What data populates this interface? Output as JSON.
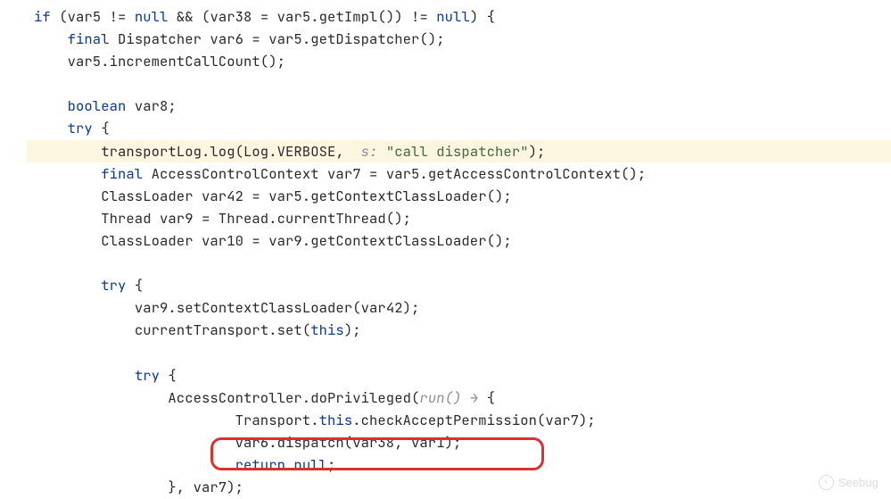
{
  "colors": {
    "keyword": "#0d3b8f",
    "string": "#446b3a",
    "inlay": "#8a8f97",
    "text": "#2b2b2b",
    "highlight_bg": "#fcf6e1",
    "redbox": "#d7322c"
  },
  "watermark": {
    "icon_label": "i",
    "text": "Seebug"
  },
  "lines": [
    {
      "indent": 0,
      "hl": false,
      "tokens": [
        {
          "t": "kw",
          "v": "if"
        },
        {
          "t": "plain",
          "v": " (var5 != "
        },
        {
          "t": "kw",
          "v": "null"
        },
        {
          "t": "plain",
          "v": " && (var38 = var5.getImpl()) != "
        },
        {
          "t": "kw",
          "v": "null"
        },
        {
          "t": "plain",
          "v": ") {"
        }
      ]
    },
    {
      "indent": 1,
      "hl": false,
      "tokens": [
        {
          "t": "kw",
          "v": "final"
        },
        {
          "t": "plain",
          "v": " Dispatcher var6 = var5.getDispatcher();"
        }
      ]
    },
    {
      "indent": 1,
      "hl": false,
      "tokens": [
        {
          "t": "plain",
          "v": "var5.incrementCallCount();"
        }
      ]
    },
    {
      "indent": 0,
      "hl": false,
      "tokens": []
    },
    {
      "indent": 1,
      "hl": false,
      "tokens": [
        {
          "t": "kw",
          "v": "boolean"
        },
        {
          "t": "plain",
          "v": " var8;"
        }
      ]
    },
    {
      "indent": 1,
      "hl": false,
      "tokens": [
        {
          "t": "kw",
          "v": "try"
        },
        {
          "t": "plain",
          "v": " {"
        }
      ]
    },
    {
      "indent": 2,
      "hl": true,
      "tokens": [
        {
          "t": "plain",
          "v": "transportLog.log(Log.VERBOSE,  "
        },
        {
          "t": "inl",
          "v": "s: "
        },
        {
          "t": "str",
          "v": "\"call dispatcher\""
        },
        {
          "t": "plain",
          "v": ");"
        }
      ]
    },
    {
      "indent": 2,
      "hl": false,
      "tokens": [
        {
          "t": "kw",
          "v": "final"
        },
        {
          "t": "plain",
          "v": " AccessControlContext var7 = var5.getAccessControlContext();"
        }
      ]
    },
    {
      "indent": 2,
      "hl": false,
      "tokens": [
        {
          "t": "plain",
          "v": "ClassLoader var42 = var5.getContextClassLoader();"
        }
      ]
    },
    {
      "indent": 2,
      "hl": false,
      "tokens": [
        {
          "t": "plain",
          "v": "Thread var9 = Thread.currentThread();"
        }
      ]
    },
    {
      "indent": 2,
      "hl": false,
      "tokens": [
        {
          "t": "plain",
          "v": "ClassLoader var10 = var9.getContextClassLoader();"
        }
      ]
    },
    {
      "indent": 0,
      "hl": false,
      "tokens": []
    },
    {
      "indent": 2,
      "hl": false,
      "tokens": [
        {
          "t": "kw",
          "v": "try"
        },
        {
          "t": "plain",
          "v": " {"
        }
      ]
    },
    {
      "indent": 3,
      "hl": false,
      "tokens": [
        {
          "t": "plain",
          "v": "var9.setContextClassLoader(var42);"
        }
      ]
    },
    {
      "indent": 3,
      "hl": false,
      "tokens": [
        {
          "t": "plain",
          "v": "currentTransport.set("
        },
        {
          "t": "kw",
          "v": "this"
        },
        {
          "t": "plain",
          "v": ");"
        }
      ]
    },
    {
      "indent": 0,
      "hl": false,
      "tokens": []
    },
    {
      "indent": 3,
      "hl": false,
      "tokens": [
        {
          "t": "kw",
          "v": "try"
        },
        {
          "t": "plain",
          "v": " {"
        }
      ]
    },
    {
      "indent": 4,
      "hl": false,
      "tokens": [
        {
          "t": "plain",
          "v": "AccessController.doPrivileged("
        },
        {
          "t": "inl",
          "v": "run() → "
        },
        {
          "t": "plain",
          "v": "{"
        }
      ]
    },
    {
      "indent": 6,
      "hl": false,
      "tokens": [
        {
          "t": "plain",
          "v": "Transport."
        },
        {
          "t": "kw",
          "v": "this"
        },
        {
          "t": "plain",
          "v": ".checkAcceptPermission(var7);"
        }
      ]
    },
    {
      "indent": 6,
      "hl": false,
      "tokens": [
        {
          "t": "plain",
          "v": "var6.dispatch(var38, var1);"
        }
      ]
    },
    {
      "indent": 6,
      "hl": false,
      "tokens": [
        {
          "t": "kw",
          "v": "return"
        },
        {
          "t": "plain",
          "v": " "
        },
        {
          "t": "kw",
          "v": "null"
        },
        {
          "t": "plain",
          "v": ";"
        }
      ]
    },
    {
      "indent": 4,
      "hl": false,
      "tokens": [
        {
          "t": "plain",
          "v": "}, var7);"
        }
      ]
    }
  ]
}
